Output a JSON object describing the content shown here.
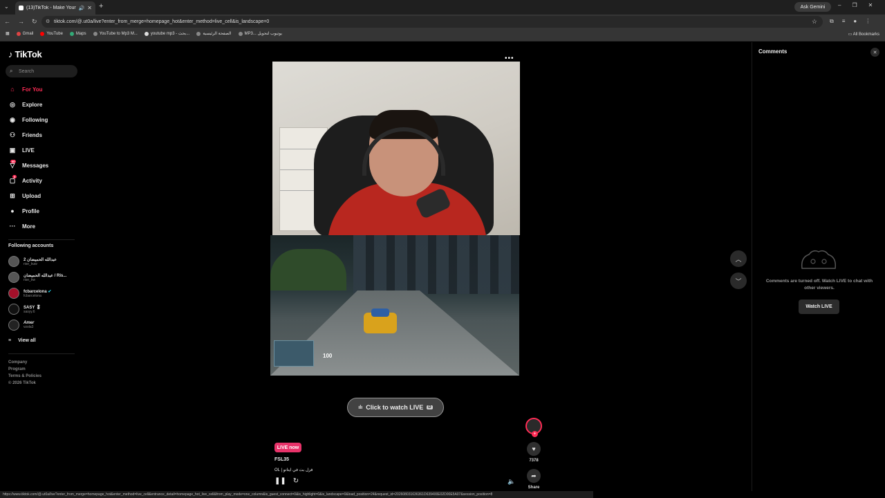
{
  "browser": {
    "tab_title": "(13)TikTok - Make Your Day",
    "url": "tiktok.com/@.ut0a/live?enter_from_merge=homepage_hot&enter_method=live_cell&is_landscape=0",
    "gemini_label": "Ask Gemini",
    "bookmarks": [
      "Gmail",
      "YouTube",
      "Maps",
      "YouTube to Mp3 M...",
      "youtube mp3 - بحث...",
      "الصفحة الرئيسية",
      "MP3... يوتيوب لتحويل"
    ],
    "all_bookmarks_label": "All Bookmarks",
    "status_url": "https://www.tiktok.com/@.ut0a/live?enter_from_merge=homepage_hot&enter_method=live_cell&entrance_detail=homepage_hot_live_cell&from_play_mode=one_column&is_guest_connect=0&is_highlight=0&is_landscape=0&load_position=24&request_id=202608031636361D639400E02D00E5A07&session_position=8"
  },
  "sidebar": {
    "logo": "TikTok",
    "search_placeholder": "Search",
    "nav": [
      {
        "label": "For You",
        "icon": "home-icon"
      },
      {
        "label": "Explore",
        "icon": "compass-icon"
      },
      {
        "label": "Following",
        "icon": "following-avatar-icon"
      },
      {
        "label": "Friends",
        "icon": "friends-icon"
      },
      {
        "label": "LIVE",
        "icon": "live-icon"
      },
      {
        "label": "Messages",
        "icon": "messages-icon",
        "badge": "60"
      },
      {
        "label": "Activity",
        "icon": "activity-icon",
        "badge": "3"
      },
      {
        "label": "Upload",
        "icon": "upload-icon"
      },
      {
        "label": "Profile",
        "icon": "profile-icon"
      },
      {
        "label": "More",
        "icon": "more-icon"
      }
    ],
    "following_heading": "Following accounts",
    "accounts": [
      {
        "name": "عبدالله الحميضان 2",
        "handle": "rise_kuw"
      },
      {
        "name": "عبدالله الحميضان / Ris...",
        "handle": "rise_kw"
      },
      {
        "name": "fcbarcelona",
        "handle": "fcbarcelona"
      },
      {
        "name": "SASY 🎖",
        "handle": "sasyy.6"
      },
      {
        "name": "Amer",
        "handle": "vzola3"
      }
    ],
    "view_all": "View all",
    "footer": [
      "Company",
      "Program",
      "Terms & Policies",
      "© 2026 TikTok"
    ]
  },
  "player": {
    "watch_live_label": "Click to watch LIVE",
    "watch_live_key": "D",
    "live_badge": "LIVE now",
    "host_name": "FSL35",
    "live_title": "OL | فزل بث في ايتاتو",
    "hud_speed": "100",
    "like_count": "7378",
    "share_label": "Share"
  },
  "comments": {
    "title": "Comments",
    "off_text": "Comments are turned off. Watch LIVE to chat with other viewers.",
    "watch_button": "Watch LIVE"
  }
}
